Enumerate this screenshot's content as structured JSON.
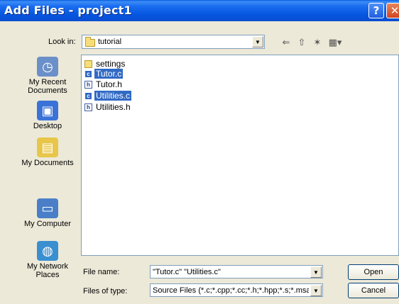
{
  "window": {
    "title": "Add Files - project1",
    "help_glyph": "?",
    "close_glyph": "✕"
  },
  "lookin": {
    "label": "Look in:",
    "value": "tutorial",
    "arrow": "▼"
  },
  "toolbar": {
    "back_glyph": "⇐",
    "up_glyph": "⇧",
    "newfolder_glyph": "✶",
    "view_glyph": "▦▾"
  },
  "places": [
    {
      "label": "My Recent Documents",
      "icon": "recent-documents-icon",
      "color": "#6b8fc9"
    },
    {
      "label": "Desktop",
      "icon": "desktop-icon",
      "color": "#3a72d8"
    },
    {
      "label": "My Documents",
      "icon": "my-documents-icon",
      "color": "#e8c64a"
    },
    {
      "label": "My Computer",
      "icon": "my-computer-icon",
      "color": "#4a7fc8"
    },
    {
      "label": "My Network Places",
      "icon": "network-places-icon",
      "color": "#3a8fd0"
    }
  ],
  "files": [
    {
      "name": "settings",
      "type": "folder",
      "selected": false
    },
    {
      "name": "Tutor.c",
      "type": "c",
      "selected": true
    },
    {
      "name": "Tutor.h",
      "type": "h",
      "selected": false
    },
    {
      "name": "Utilities.c",
      "type": "c",
      "selected": true
    },
    {
      "name": "Utilities.h",
      "type": "h",
      "selected": false
    }
  ],
  "file_name": {
    "label": "File name:",
    "value": "\"Tutor.c\" \"Utilities.c\""
  },
  "file_type": {
    "label": "Files of type:",
    "value": "Source Files (*.c;*.cpp;*.cc;*.h;*.hpp;*.s;*.msa"
  },
  "buttons": {
    "open": "Open",
    "cancel": "Cancel"
  },
  "colors": {
    "selection": "#316ac5",
    "titlebar": "#0a5fe4",
    "face": "#ece9d8"
  }
}
